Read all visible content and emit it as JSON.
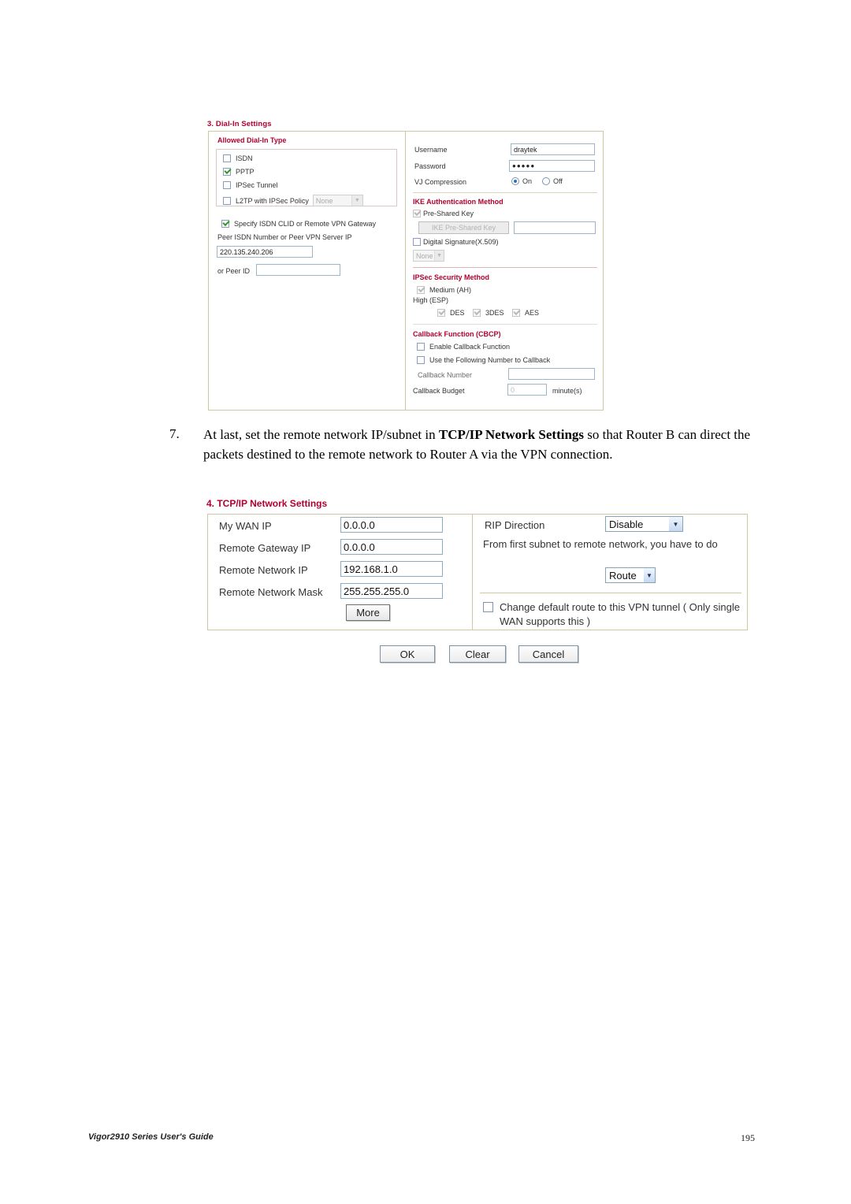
{
  "panel3": {
    "title": "3. Dial-In Settings",
    "allowed_dial_in_type": {
      "title": "Allowed Dial-In Type",
      "items": [
        {
          "label": "ISDN",
          "checked": false
        },
        {
          "label": "PPTP",
          "checked": true
        },
        {
          "label": "IPSec Tunnel",
          "checked": false
        },
        {
          "label": "L2TP with IPSec Policy",
          "checked": false
        }
      ],
      "l2tp_policy_value": "None"
    },
    "specify_isdn_clid_label": "Specify ISDN CLID or Remote VPN Gateway",
    "specify_isdn_clid_checked": true,
    "peer_isdn_label": "Peer ISDN Number or Peer VPN Server IP",
    "peer_isdn_value": "220.135.240.206",
    "or_peer_id_label": "or Peer ID",
    "or_peer_id_value": "",
    "username_label": "Username",
    "username_value": "draytek",
    "password_label": "Password",
    "password_value": "●●●●●",
    "vj_compression_label": "VJ Compression",
    "vj_on_label": "On",
    "vj_off_label": "Off",
    "vj_selected": "On",
    "ike_title": "IKE Authentication Method",
    "pre_shared_key_label": "Pre-Shared Key",
    "pre_shared_key_checked": true,
    "ike_pre_shared_key_button": "IKE Pre-Shared Key",
    "ike_pre_shared_key_value": "",
    "digital_signature_label": "Digital Signature(X.509)",
    "digital_signature_checked": false,
    "digital_signature_select": "None",
    "ipsec_title": "IPSec Security Method",
    "medium_ah_label": "Medium (AH)",
    "medium_ah_checked": true,
    "high_esp_label": "High (ESP)",
    "esp_items": [
      {
        "label": "DES",
        "checked": true
      },
      {
        "label": "3DES",
        "checked": true
      },
      {
        "label": "AES",
        "checked": true
      }
    ],
    "callback_title": "Callback Function (CBCP)",
    "enable_callback_label": "Enable Callback Function",
    "enable_callback_checked": false,
    "use_following_number_label": "Use the Following Number to Callback",
    "use_following_number_checked": false,
    "callback_number_label": "Callback Number",
    "callback_number_value": "",
    "callback_budget_label": "Callback Budget",
    "callback_budget_value": "0",
    "callback_budget_unit": "minute(s)"
  },
  "step7": {
    "number": "7.",
    "text_part1": "At last, set the remote network IP/subnet in ",
    "bold": "TCP/IP Network Settings",
    "text_part2": " so that Router B can direct the packets destined to the remote network to Router A via the VPN connection."
  },
  "panel4": {
    "title": "4. TCP/IP Network Settings",
    "fields": [
      {
        "label": "My WAN IP",
        "value": "0.0.0.0"
      },
      {
        "label": "Remote Gateway IP",
        "value": "0.0.0.0"
      },
      {
        "label": "Remote Network IP",
        "value": "192.168.1.0"
      },
      {
        "label": "Remote Network Mask",
        "value": "255.255.255.0"
      }
    ],
    "more_button": "More",
    "rip_direction_label": "RIP Direction",
    "rip_direction_value": "Disable",
    "subnet_note": "From first subnet to remote network, you have to do",
    "route_select_value": "Route",
    "change_default_route_label": "Change default route to this VPN tunnel ( Only single WAN supports this )",
    "change_default_route_checked": false
  },
  "buttons": {
    "ok": "OK",
    "clear": "Clear",
    "cancel": "Cancel"
  },
  "footer": {
    "left": "Vigor2910 Series User's Guide",
    "right": "195"
  }
}
